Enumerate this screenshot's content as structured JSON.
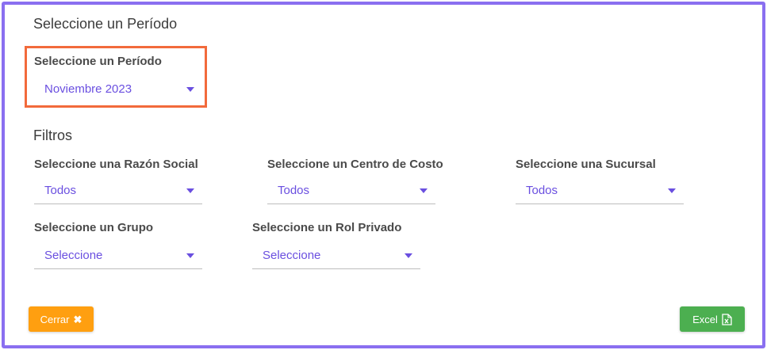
{
  "period_section": {
    "title": "Seleccione un Período",
    "field_label": "Seleccione un Período",
    "selected": "Noviembre 2023"
  },
  "filters": {
    "title": "Filtros",
    "razon_social": {
      "label": "Seleccione una Razón Social",
      "selected": "Todos"
    },
    "centro_costo": {
      "label": "Seleccione un Centro de Costo",
      "selected": "Todos"
    },
    "sucursal": {
      "label": "Seleccione una Sucursal",
      "selected": "Todos"
    },
    "grupo": {
      "label": "Seleccione un Grupo",
      "selected": "Seleccione"
    },
    "rol_privado": {
      "label": "Seleccione un Rol Privado",
      "selected": "Seleccione"
    }
  },
  "actions": {
    "close_label": "Cerrar",
    "excel_label": "Excel"
  },
  "colors": {
    "frame_border": "#8a6ff0",
    "highlight_border": "#f26a3b",
    "select_text": "#6a4fe0",
    "close_button": "#ff9f10",
    "excel_button": "#4caf50"
  }
}
